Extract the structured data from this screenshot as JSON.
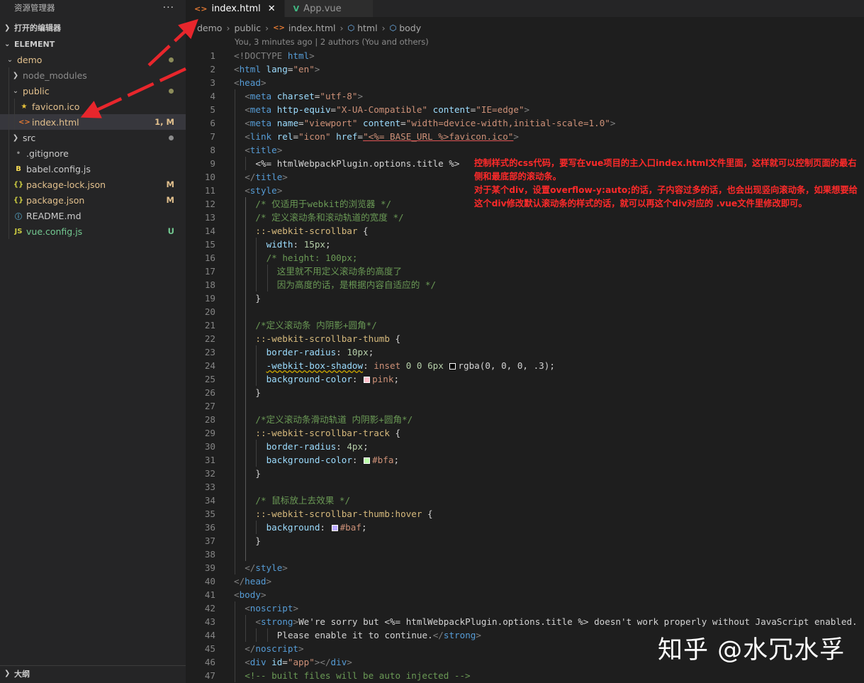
{
  "sidebar": {
    "title": "资源管理器",
    "more": "···",
    "open_editors": "打开的编辑器",
    "section": "ELEMENT",
    "items": [
      {
        "label": "demo",
        "type": "folder-open",
        "color": "#e2c08d",
        "dot": "#8c8c5a",
        "badge": ""
      },
      {
        "label": "node_modules",
        "type": "folder",
        "color": "#8c8c8c",
        "dot": "",
        "badge": ""
      },
      {
        "label": "public",
        "type": "folder-open",
        "color": "#e2c08d",
        "dot": "#8c8c5a",
        "badge": ""
      },
      {
        "label": "favicon.ico",
        "type": "star",
        "color": "#e2c08d",
        "dot": "",
        "badge": ""
      },
      {
        "label": "index.html",
        "type": "html",
        "color": "#e2c08d",
        "dot": "",
        "badge": "1, M"
      },
      {
        "label": "src",
        "type": "folder",
        "color": "#cccccc",
        "dot": "#8c8c8c",
        "badge": ""
      },
      {
        "label": ".gitignore",
        "type": "dot",
        "color": "#cccccc",
        "dot": "",
        "badge": ""
      },
      {
        "label": "babel.config.js",
        "type": "babel",
        "color": "#cccccc",
        "dot": "",
        "badge": ""
      },
      {
        "label": "package-lock.json",
        "type": "json",
        "color": "#e2c08d",
        "dot": "",
        "badge": "M"
      },
      {
        "label": "package.json",
        "type": "json",
        "color": "#e2c08d",
        "dot": "",
        "badge": "M"
      },
      {
        "label": "README.md",
        "type": "info",
        "color": "#cccccc",
        "dot": "",
        "badge": ""
      },
      {
        "label": "vue.config.js",
        "type": "js",
        "color": "#73c991",
        "dot": "",
        "badge": "U"
      }
    ],
    "outline": "大纲"
  },
  "tabs": [
    {
      "label": "index.html",
      "icon": "<>",
      "active": true,
      "close": "✕"
    },
    {
      "label": "App.vue",
      "icon": "V",
      "active": false,
      "close": ""
    }
  ],
  "breadcrumb": [
    "demo",
    "public",
    "index.html",
    "html",
    "body"
  ],
  "blame": "You, 3 minutes ago | 2 authors (You and others)",
  "annotation": {
    "line1": "控制样式的css代码，要写在vue项目的主入口index.html文件里面，这样就可以控制页面的最右侧和最底部的滚动条。",
    "line2": "对于某个div，设置overflow-y:auto;的话，子内容过多的话，也会出现竖向滚动条，如果想要给这个div修改默认滚动条的样式的话，就可以再这个div对应的 .vue文件里修改即可。"
  },
  "watermark": "知乎 @水冗水孚",
  "colors": {
    "pink": "#ffc0cb",
    "bfa": "#bbffaa",
    "baf": "#bbaaff",
    "annotation": "#ff2a2a"
  },
  "code_lines": [
    {
      "n": "1",
      "indent": 0,
      "t": [
        [
          "kw",
          "<!DOCTYPE "
        ],
        [
          "tag",
          "html"
        ],
        [
          "kw",
          ">"
        ]
      ]
    },
    {
      "n": "2",
      "indent": 0,
      "t": [
        [
          "kw",
          "<"
        ],
        [
          "tag",
          "html"
        ],
        [
          "attr",
          " lang"
        ],
        [
          "plain",
          "="
        ],
        [
          "str",
          "\"en\""
        ],
        [
          "kw",
          ">"
        ]
      ]
    },
    {
      "n": "3",
      "indent": 0,
      "t": [
        [
          "kw",
          "<"
        ],
        [
          "tag",
          "head"
        ],
        [
          "kw",
          ">"
        ]
      ]
    },
    {
      "n": "4",
      "indent": 1,
      "t": [
        [
          "kw",
          "<"
        ],
        [
          "tag",
          "meta"
        ],
        [
          "attr",
          " charset"
        ],
        [
          "plain",
          "="
        ],
        [
          "str",
          "\"utf-8\""
        ],
        [
          "kw",
          ">"
        ]
      ]
    },
    {
      "n": "5",
      "indent": 1,
      "t": [
        [
          "kw",
          "<"
        ],
        [
          "tag",
          "meta"
        ],
        [
          "attr",
          " http-equiv"
        ],
        [
          "plain",
          "="
        ],
        [
          "str",
          "\"X-UA-Compatible\""
        ],
        [
          "attr",
          " content"
        ],
        [
          "plain",
          "="
        ],
        [
          "str",
          "\"IE=edge\""
        ],
        [
          "kw",
          ">"
        ]
      ]
    },
    {
      "n": "6",
      "indent": 1,
      "t": [
        [
          "kw",
          "<"
        ],
        [
          "tag",
          "meta"
        ],
        [
          "attr",
          " name"
        ],
        [
          "plain",
          "="
        ],
        [
          "str",
          "\"viewport\""
        ],
        [
          "attr",
          " content"
        ],
        [
          "plain",
          "="
        ],
        [
          "str",
          "\"width=device-width,initial-scale=1.0\""
        ],
        [
          "kw",
          ">"
        ]
      ]
    },
    {
      "n": "7",
      "indent": 1,
      "t": [
        [
          "kw",
          "<"
        ],
        [
          "tag",
          "link"
        ],
        [
          "attr",
          " rel"
        ],
        [
          "plain",
          "="
        ],
        [
          "str",
          "\"icon\""
        ],
        [
          "attr",
          " href"
        ],
        [
          "plain",
          "="
        ],
        [
          "ulred",
          "\"<%= BASE_URL %>favicon.ico\""
        ],
        [
          "kw",
          ">"
        ]
      ]
    },
    {
      "n": "8",
      "indent": 1,
      "t": [
        [
          "kw",
          "<"
        ],
        [
          "tag",
          "title"
        ],
        [
          "kw",
          ">"
        ]
      ]
    },
    {
      "n": "9",
      "indent": 2,
      "t": [
        [
          "plain",
          "<%= htmlWebpackPlugin.options.title %>"
        ]
      ]
    },
    {
      "n": "10",
      "indent": 1,
      "t": [
        [
          "kw",
          "</"
        ],
        [
          "tag",
          "title"
        ],
        [
          "kw",
          ">"
        ]
      ]
    },
    {
      "n": "11",
      "indent": 1,
      "t": [
        [
          "kw",
          "<"
        ],
        [
          "tag",
          "style"
        ],
        [
          "kw",
          ">"
        ]
      ]
    },
    {
      "n": "12",
      "indent": 2,
      "t": [
        [
          "cmt",
          "/* 仅适用于webkit的浏览器 */"
        ]
      ]
    },
    {
      "n": "13",
      "indent": 2,
      "t": [
        [
          "cmt",
          "/* 定义滚动条和滚动轨道的宽度 */"
        ]
      ]
    },
    {
      "n": "14",
      "indent": 2,
      "t": [
        [
          "sel",
          "::-webkit-scrollbar"
        ],
        [
          "plain",
          " {"
        ]
      ]
    },
    {
      "n": "15",
      "indent": 3,
      "t": [
        [
          "prop",
          "width"
        ],
        [
          "plain",
          ": "
        ],
        [
          "num",
          "15px"
        ],
        [
          "plain",
          ";"
        ]
      ]
    },
    {
      "n": "16",
      "indent": 3,
      "t": [
        [
          "cmt",
          "/* height: 100px;"
        ]
      ]
    },
    {
      "n": "17",
      "indent": 4,
      "t": [
        [
          "cmt",
          "这里就不用定义滚动条的高度了"
        ]
      ]
    },
    {
      "n": "18",
      "indent": 4,
      "t": [
        [
          "cmt",
          "因为高度的话，是根据内容自适应的 */"
        ]
      ]
    },
    {
      "n": "19",
      "indent": 2,
      "t": [
        [
          "plain",
          "}"
        ]
      ]
    },
    {
      "n": "20",
      "indent": 0,
      "t": []
    },
    {
      "n": "21",
      "indent": 2,
      "t": [
        [
          "cmt",
          "/*定义滚动条 内阴影+圆角*/"
        ]
      ]
    },
    {
      "n": "22",
      "indent": 2,
      "t": [
        [
          "sel",
          "::-webkit-scrollbar-thumb"
        ],
        [
          "plain",
          " {"
        ]
      ]
    },
    {
      "n": "23",
      "indent": 3,
      "t": [
        [
          "prop",
          "border-radius"
        ],
        [
          "plain",
          ": "
        ],
        [
          "num",
          "10px"
        ],
        [
          "plain",
          ";"
        ]
      ]
    },
    {
      "n": "24",
      "indent": 3,
      "t": [
        [
          "squig",
          "-webkit-box-shadow"
        ],
        [
          "plain",
          ": "
        ],
        [
          "kwv",
          "inset "
        ],
        [
          "num",
          "0 0 6px "
        ],
        [
          "sw",
          "#000000"
        ],
        [
          "plain",
          "rgba(0, 0, 0, .3);"
        ]
      ]
    },
    {
      "n": "25",
      "indent": 3,
      "t": [
        [
          "prop",
          "background-color"
        ],
        [
          "plain",
          ": "
        ],
        [
          "sw",
          "#ffc0cb"
        ],
        [
          "val",
          "pink"
        ],
        [
          "plain",
          ";"
        ]
      ]
    },
    {
      "n": "26",
      "indent": 2,
      "t": [
        [
          "plain",
          "}"
        ]
      ]
    },
    {
      "n": "27",
      "indent": 0,
      "t": []
    },
    {
      "n": "28",
      "indent": 2,
      "t": [
        [
          "cmt",
          "/*定义滚动条滑动轨道 内阴影+圆角*/"
        ]
      ]
    },
    {
      "n": "29",
      "indent": 2,
      "t": [
        [
          "sel",
          "::-webkit-scrollbar-track"
        ],
        [
          "plain",
          " {"
        ]
      ]
    },
    {
      "n": "30",
      "indent": 3,
      "t": [
        [
          "prop",
          "border-radius"
        ],
        [
          "plain",
          ": "
        ],
        [
          "num",
          "4px"
        ],
        [
          "plain",
          ";"
        ]
      ]
    },
    {
      "n": "31",
      "indent": 3,
      "t": [
        [
          "prop",
          "background-color"
        ],
        [
          "plain",
          ": "
        ],
        [
          "sw",
          "#bbffaa"
        ],
        [
          "val",
          "#bfa"
        ],
        [
          "plain",
          ";"
        ]
      ]
    },
    {
      "n": "32",
      "indent": 2,
      "t": [
        [
          "plain",
          "}"
        ]
      ]
    },
    {
      "n": "33",
      "indent": 0,
      "t": []
    },
    {
      "n": "34",
      "indent": 2,
      "t": [
        [
          "cmt",
          "/* 鼠标放上去效果 */"
        ]
      ]
    },
    {
      "n": "35",
      "indent": 2,
      "t": [
        [
          "sel",
          "::-webkit-scrollbar-thumb:hover"
        ],
        [
          "plain",
          " {"
        ]
      ]
    },
    {
      "n": "36",
      "indent": 3,
      "t": [
        [
          "prop",
          "background"
        ],
        [
          "plain",
          ": "
        ],
        [
          "sw",
          "#bbaaff"
        ],
        [
          "val",
          "#baf"
        ],
        [
          "plain",
          ";"
        ]
      ]
    },
    {
      "n": "37",
      "indent": 2,
      "t": [
        [
          "plain",
          "}"
        ]
      ]
    },
    {
      "n": "38",
      "indent": 0,
      "t": []
    },
    {
      "n": "39",
      "indent": 1,
      "t": [
        [
          "kw",
          "</"
        ],
        [
          "tag",
          "style"
        ],
        [
          "kw",
          ">"
        ]
      ]
    },
    {
      "n": "40",
      "indent": 0,
      "t": [
        [
          "kw",
          "</"
        ],
        [
          "tag",
          "head"
        ],
        [
          "kw",
          ">"
        ]
      ]
    },
    {
      "n": "41",
      "indent": 0,
      "t": [
        [
          "kw",
          "<"
        ],
        [
          "tag",
          "body"
        ],
        [
          "kw",
          ">"
        ]
      ]
    },
    {
      "n": "42",
      "indent": 1,
      "t": [
        [
          "kw",
          "<"
        ],
        [
          "tag",
          "noscript"
        ],
        [
          "kw",
          ">"
        ]
      ]
    },
    {
      "n": "43",
      "indent": 2,
      "t": [
        [
          "kw",
          "<"
        ],
        [
          "tag",
          "strong"
        ],
        [
          "kw",
          ">"
        ],
        [
          "plain",
          "We're sorry but <%= htmlWebpackPlugin.options.title %> doesn't work properly without JavaScript enabled."
        ]
      ]
    },
    {
      "n": "44",
      "indent": 4,
      "t": [
        [
          "plain",
          "Please enable it to continue."
        ],
        [
          "kw",
          "</"
        ],
        [
          "tag",
          "strong"
        ],
        [
          "kw",
          ">"
        ]
      ]
    },
    {
      "n": "45",
      "indent": 1,
      "t": [
        [
          "kw",
          "</"
        ],
        [
          "tag",
          "noscript"
        ],
        [
          "kw",
          ">"
        ]
      ]
    },
    {
      "n": "46",
      "indent": 1,
      "t": [
        [
          "kw",
          "<"
        ],
        [
          "tag",
          "div"
        ],
        [
          "attr",
          " id"
        ],
        [
          "plain",
          "="
        ],
        [
          "str",
          "\"app\""
        ],
        [
          "kw",
          "></"
        ],
        [
          "tag",
          "div"
        ],
        [
          "kw",
          ">"
        ]
      ]
    },
    {
      "n": "47",
      "indent": 1,
      "t": [
        [
          "cmt",
          "<!-- built files will be auto injected -->"
        ]
      ]
    }
  ]
}
